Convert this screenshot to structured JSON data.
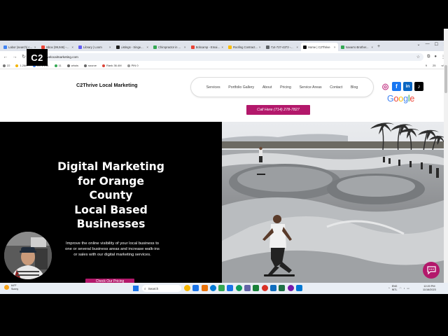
{
  "browser": {
    "tabs": [
      {
        "title": "Labor (search) c...",
        "color": "#4285f4",
        "active": false
      },
      {
        "title": "Inbox (99,946) -...",
        "color": "#ea4335",
        "active": false
      },
      {
        "title": "Library | Loom",
        "color": "#625df5",
        "active": false
      },
      {
        "title": "Listings - Singe...",
        "color": "#1f1f1f",
        "active": false
      },
      {
        "title": "Chiropractor in ...",
        "color": "#34a853",
        "active": false
      },
      {
        "title": "Bobcamp - Email ...",
        "color": "#ea4335",
        "active": false
      },
      {
        "title": "Roofing Contract...",
        "color": "#fbbc05",
        "active": false
      },
      {
        "title": "714-727-4373 -...",
        "color": "#5f6368",
        "active": false
      },
      {
        "title": "Home | C2Thrive",
        "color": "#111111",
        "active": true
      },
      {
        "title": "Navarro Brother...",
        "color": "#34a853",
        "active": false
      }
    ],
    "new_tab": "+",
    "window_controls": [
      "⌄",
      "—",
      "☐",
      "✕"
    ],
    "url": "c2thrivelocalmarketing.com",
    "extensions": [
      {
        "label": "22",
        "color": "#777777"
      },
      {
        "label": "1.26K",
        "color": "#f4b400"
      },
      {
        "label": "LD 1.19K",
        "color": "#4285f4"
      },
      {
        "label": "11",
        "color": "#34a853"
      },
      {
        "label": "whois",
        "color": "#666666"
      },
      {
        "label": "source",
        "color": "#666666"
      },
      {
        "label": "Rank 36.4M",
        "color": "#db4437"
      },
      {
        "label": "PIN 0",
        "color": "#999999"
      }
    ],
    "ext_right": [
      "9",
      "25",
      "n/a"
    ]
  },
  "site": {
    "logo": "C2",
    "brand": "C2Thrive Local Marketing",
    "nav": [
      "Services",
      "Portfolio Gallery",
      "About",
      "Pricing",
      "Service Areas",
      "Contact",
      "Blog"
    ],
    "social": [
      {
        "name": "instagram",
        "glyph": "◎",
        "color": "#c13584"
      },
      {
        "name": "facebook",
        "glyph": "f",
        "color": "#1877f2"
      },
      {
        "name": "linkedin",
        "glyph": "in",
        "color": "#0a66c2"
      },
      {
        "name": "tiktok",
        "glyph": "♪",
        "color": "#000000"
      }
    ],
    "google_letters": [
      {
        "ch": "G",
        "color": "#4285f4"
      },
      {
        "ch": "o",
        "color": "#ea4335"
      },
      {
        "ch": "o",
        "color": "#fbbc05"
      },
      {
        "ch": "g",
        "color": "#4285f4"
      },
      {
        "ch": "l",
        "color": "#34a853"
      },
      {
        "ch": "e",
        "color": "#ea4335"
      }
    ],
    "call_button": "Call Here (714) 278-7827",
    "hero": {
      "title_lines": [
        "Digital Marketing",
        "for Orange",
        "County",
        "Local Based",
        "Businesses"
      ],
      "text": "Improve the online visibility of your local business to one or several business areas and increase walk-ins or sales with our digital marketing services.",
      "cta": "Check Our Pricing"
    },
    "accent": "#b3186b"
  },
  "taskbar": {
    "weather_temp": "64°F",
    "weather_desc": "Sunny",
    "search_placeholder": "Search",
    "apps": [
      "#f4b400",
      "#1a73e8",
      "#e8710a",
      "#0078d4",
      "#34a853",
      "#1a73e8",
      "#0f9d58",
      "#6264a7",
      "#188038",
      "#d93025",
      "#0f6cbd",
      "#1e7145",
      "#7719aa",
      "#0078d4"
    ],
    "tray": [
      "ENG",
      "INTL"
    ],
    "time": "12:20 PM",
    "date": "11/16/2023"
  }
}
